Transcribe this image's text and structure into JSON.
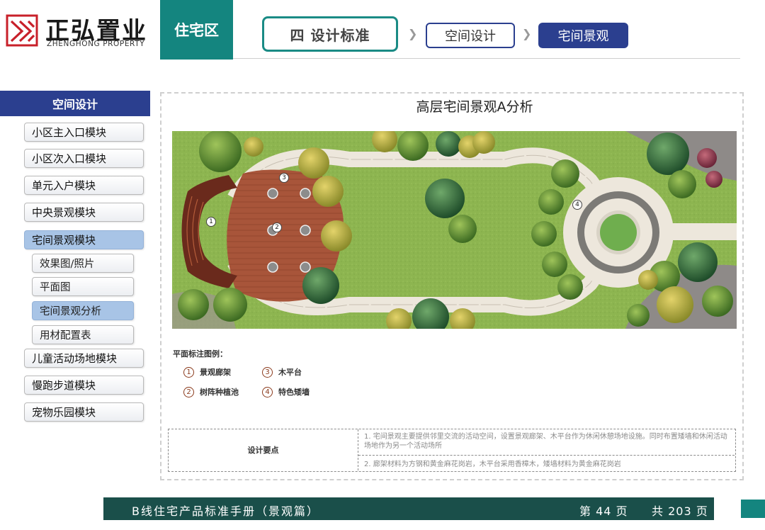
{
  "header": {
    "company_cn": "正弘置业",
    "company_en": "ZHENGHONG PROPERTY",
    "section": "住宅区",
    "breadcrumb": [
      "四  设计标准",
      "空间设计",
      "宅间景观"
    ],
    "accent_color": "#14857f",
    "primary_color": "#2b3f8f"
  },
  "sidebar": {
    "heading": "空间设计",
    "items": [
      "小区主入口模块",
      "小区次入口模块",
      "单元入户模块",
      "中央景观模块",
      "宅间景观模块"
    ],
    "sub_items": [
      "效果图/照片",
      "平面图",
      "宅间景观分析",
      "用材配置表"
    ],
    "items_after": [
      "儿童活动场地模块",
      "慢跑步道模块",
      "宠物乐园模块"
    ]
  },
  "content": {
    "title": "高层宅间景观A分析",
    "plan_markers": [
      "1",
      "2",
      "3",
      "4"
    ],
    "legend_title": "平面标注图例：",
    "legend": [
      {
        "num": "1",
        "label": "景观廊架"
      },
      {
        "num": "2",
        "label": "树阵种植池"
      },
      {
        "num": "3",
        "label": "木平台"
      },
      {
        "num": "4",
        "label": "特色矮墙"
      }
    ],
    "design_points_label": "设计要点",
    "design_points": [
      "1. 宅间景观主要提供邻里交流的活动空间，设置景观廊架、木平台作为休闲休憩场地设施。同时布置矮墙和休闲活动场地作为另一个活动场所",
      "2. 廊架材料为方钢和黄金麻花岗岩，木平台采用香樟木，矮墙材料为黄金麻花岗岩"
    ]
  },
  "footer": {
    "title": "B线住宅产品标准手册（景观篇）",
    "page": "第 44 页",
    "total": "共 203 页"
  }
}
